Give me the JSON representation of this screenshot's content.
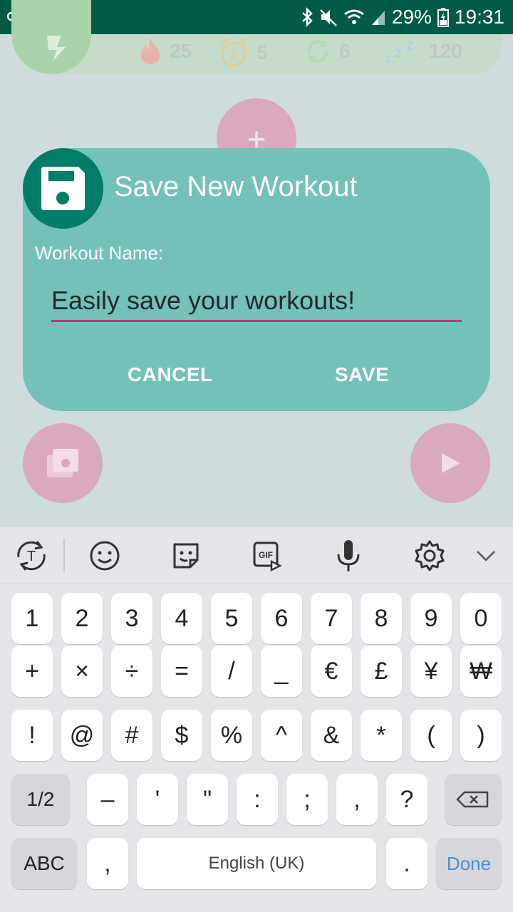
{
  "status_bar": {
    "battery": "29%",
    "time": "19:31"
  },
  "stats": {
    "calories": "25",
    "timer": "5",
    "repeats": "6",
    "rest": "120"
  },
  "dialog": {
    "title": "Save New Workout",
    "field_label": "Workout Name:",
    "field_value": "Easily save your workouts!",
    "cancel_label": "CANCEL",
    "save_label": "SAVE"
  },
  "keyboard": {
    "row1": [
      "1",
      "2",
      "3",
      "4",
      "5",
      "6",
      "7",
      "8",
      "9",
      "0"
    ],
    "row2": [
      "+",
      "×",
      "÷",
      "=",
      "/",
      "_",
      "€",
      "£",
      "¥",
      "₩"
    ],
    "row3": [
      "!",
      "@",
      "#",
      "$",
      "%",
      "^",
      "&",
      "*",
      "(",
      ")"
    ],
    "row4": [
      "1/2",
      "–",
      "'",
      "\"",
      ":",
      ";",
      ",",
      "?"
    ],
    "row5": {
      "abc": "ABC",
      "comma": ",",
      "space": "English (UK)",
      "period": ".",
      "done": "Done"
    }
  },
  "colors": {
    "status_bar": "#005a45",
    "dialog_bg": "#74c1b7",
    "dialog_icon_bg": "#007e68",
    "input_underline": "#c8336f",
    "done_blue": "#4a90c8"
  }
}
